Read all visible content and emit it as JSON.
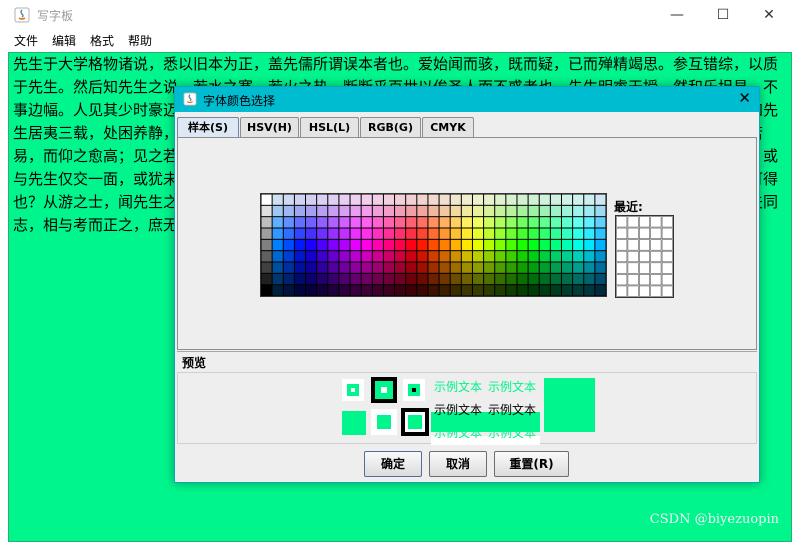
{
  "window": {
    "title": "写字板",
    "controls": {
      "minimize": "—",
      "maximize": "☐",
      "close": "✕"
    }
  },
  "menubar": {
    "items": [
      "文件",
      "编辑",
      "格式",
      "帮助"
    ]
  },
  "editor": {
    "background": "#00f58c",
    "text": "先生于大学格物诸说，悉以旧本为正，盖先儒所谓误本者也。爱始闻而骇，既而疑，已而殚精竭思。参互错综，以质于先生。然后知先生之说，若水之寒，若火之热，断断乎百世以俟圣人而不惑者也。先生明睿天授，然和乐坦易，不事边幅。人见其少时豪迈不羁，又尝泛滥于词章，出入二氏之学。骤闻是说，皆目以为立异好奇，漫不省究。不知先生居夷三载，处困养静，精一之功，固已超入圣域，粹然大中至正之归矣。爱朝夕炙门下，但见先生之道，即之若易，而仰之愈高；见之若粗，而探之愈精。就之若近，而造之愈益无穷。十余年来，竟未能窥其藩篱。世之君子，或与先生仅交一面，或犹未闻其謦咳，或先怀忽易愤激之心，而遽欲于立谈之间，传闻之说，臆断悬度，如之何其可得也？从游之士，闻先生之教，往往得一而遗二，见其牝牡骊黄，而弃其所谓千里者。故备录平日之所闻，私以示夫同志，相与考而正之，庶无负先生之教云。"
  },
  "watermark": "CSDN @biyezuopin",
  "dialog": {
    "title": "字体颜色选择",
    "close_icon": "✕",
    "tabs": [
      {
        "label": "样本(S)",
        "active": true
      },
      {
        "label": "HSV(H)",
        "active": false
      },
      {
        "label": "HSL(L)",
        "active": false
      },
      {
        "label": "RGB(G)",
        "active": false
      },
      {
        "label": "CMYK",
        "active": false
      }
    ],
    "swatches": {
      "columns": 31,
      "rows": 9
    },
    "recent": {
      "label": "最近:",
      "columns": 5,
      "rows": 7
    },
    "preview": {
      "label": "预览",
      "color": "#00f58c",
      "sample_text": "示例文本"
    },
    "buttons": {
      "ok": "确定",
      "cancel": "取消",
      "reset": "重置(R)"
    }
  }
}
